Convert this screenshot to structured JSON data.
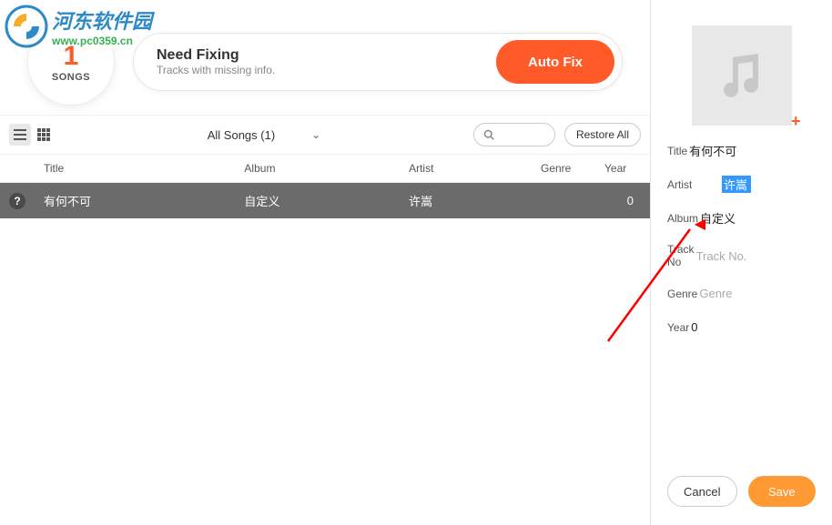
{
  "watermark": {
    "title": "河东软件园",
    "url": "www.pc0359.cn"
  },
  "header": {
    "song_count": "1",
    "songs_label": "SONGS",
    "fix_title": "Need Fixing",
    "fix_sub": "Tracks with missing info.",
    "auto_fix": "Auto Fix"
  },
  "toolbar": {
    "filter_label": "All Songs (1)",
    "restore": "Restore All"
  },
  "table": {
    "headers": {
      "title": "Title",
      "album": "Album",
      "artist": "Artist",
      "genre": "Genre",
      "year": "Year"
    },
    "row": {
      "title": "有何不可",
      "album": "自定义",
      "artist": "许嵩",
      "genre": "",
      "year": "0"
    }
  },
  "side": {
    "labels": {
      "title": "Title",
      "artist": "Artist",
      "album": "Album",
      "trackno": "Track No",
      "genre": "Genre",
      "year": "Year"
    },
    "values": {
      "title": "有何不可",
      "artist": "许嵩",
      "album": "自定义",
      "year": "0"
    },
    "placeholders": {
      "trackno": "Track No.",
      "genre": "Genre"
    },
    "cancel": "Cancel",
    "save": "Save"
  }
}
